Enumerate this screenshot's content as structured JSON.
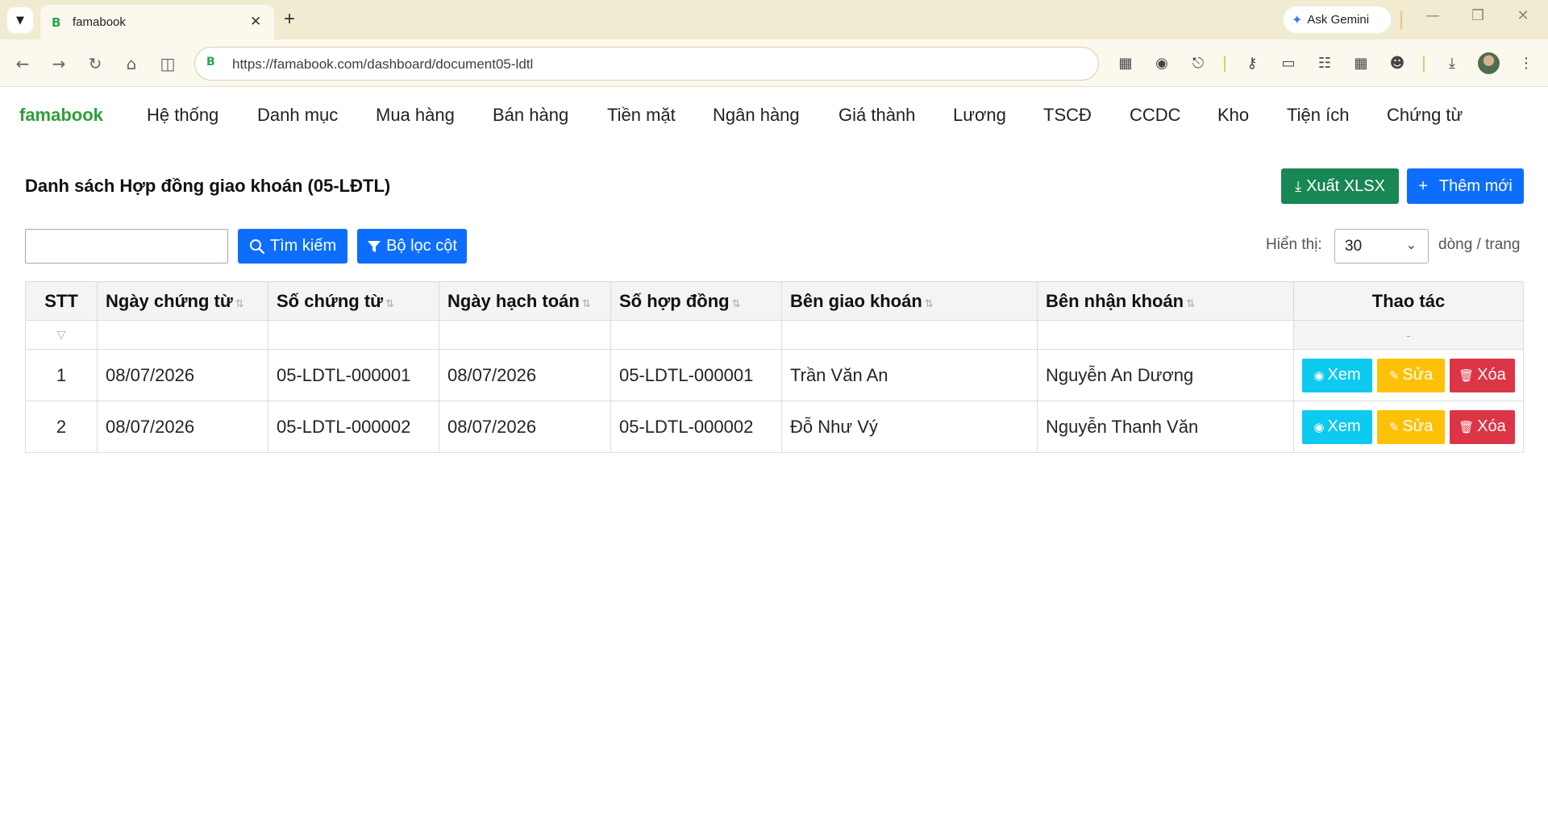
{
  "browser": {
    "tab_title": "famabook",
    "tab_favicon": "B",
    "new_tab": "+",
    "gemini_label": "Ask Gemini",
    "url": "https://famabook.com/dashboard/document05-ldtl"
  },
  "app": {
    "brand": "famabook",
    "menu": [
      "Hệ thống",
      "Danh mục",
      "Mua hàng",
      "Bán hàng",
      "Tiền mặt",
      "Ngân hàng",
      "Giá thành",
      "Lương",
      "TSCĐ",
      "CCDC",
      "Kho",
      "Tiện ích",
      "Chứng từ"
    ]
  },
  "page": {
    "title": "Danh sách Hợp đồng giao khoán (05-LĐTL)",
    "export_label": "Xuất XLSX",
    "add_label": "Thêm mới",
    "search_label": "Tìm kiếm",
    "filter_label": "Bộ lọc cột",
    "show_label": "Hiển thị:",
    "page_size": "30",
    "per_page_label": "dòng / trang"
  },
  "table": {
    "headers": [
      "STT",
      "Ngày chứng từ",
      "Số chứng từ",
      "Ngày hạch toán",
      "Số hợp đồng",
      "Bên giao khoán",
      "Bên nhận khoán",
      "Thao tác"
    ],
    "filter_dash": "-",
    "rows": [
      {
        "stt": "1",
        "ngay_chung_tu": "08/07/2026",
        "so_chung_tu": "05-LDTL-000001",
        "ngay_hach_toan": "08/07/2026",
        "so_hop_dong": "05-LDTL-000001",
        "ben_giao": "Trần Văn An",
        "ben_nhan": "Nguyễn An Dương"
      },
      {
        "stt": "2",
        "ngay_chung_tu": "08/07/2026",
        "so_chung_tu": "05-LDTL-000002",
        "ngay_hach_toan": "08/07/2026",
        "so_hop_dong": "05-LDTL-000002",
        "ben_giao": "Đỗ Như Vý",
        "ben_nhan": "Nguyễn Thanh Văn"
      }
    ],
    "actions": {
      "view": "Xem",
      "edit": "Sửa",
      "delete": "Xóa"
    }
  },
  "colors": {
    "brand": "#2e9e3a",
    "primary": "#0d6efd",
    "success": "#198754",
    "info": "#0dcaf0",
    "warning": "#ffc107",
    "danger": "#dc3545"
  }
}
